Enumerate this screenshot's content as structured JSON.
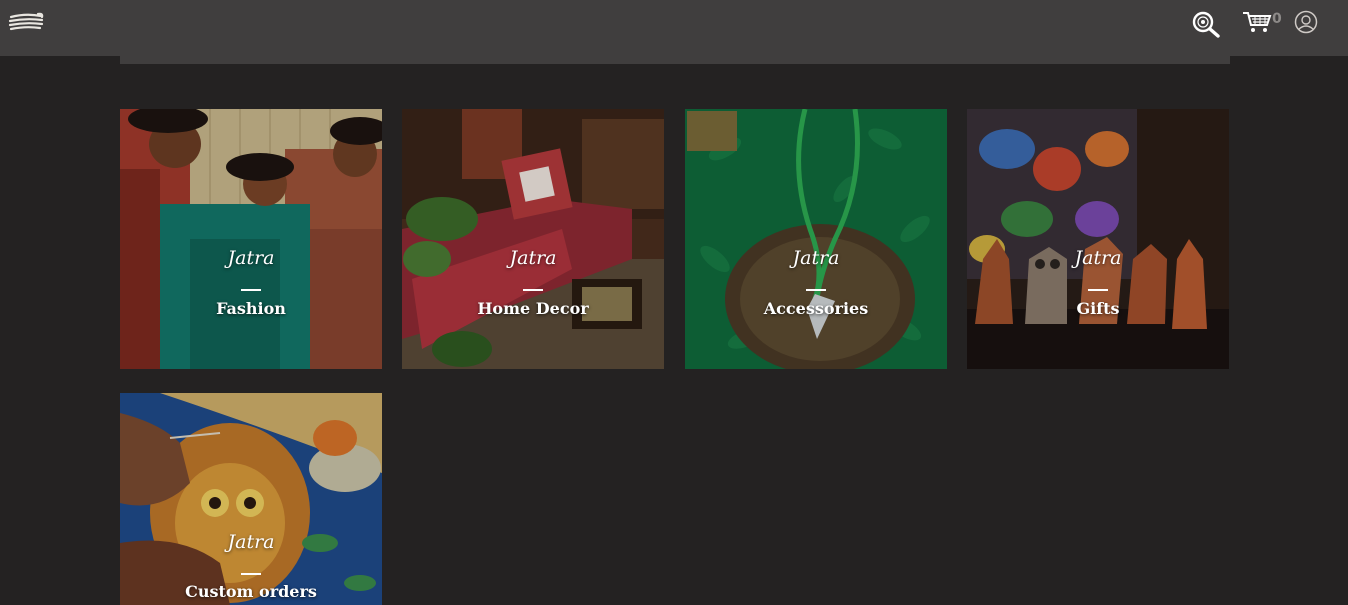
{
  "header": {
    "menu_icon": "rope-coil-menu-icon",
    "search_icon": "magnifier-search-icon",
    "cart_icon": "shopping-cart-icon",
    "cart_count": "0",
    "account_icon": "user-avatar-icon"
  },
  "categories": [
    {
      "brand": "Jatra",
      "label": "Fashion"
    },
    {
      "brand": "Jatra",
      "label": "Home Decor"
    },
    {
      "brand": "Jatra",
      "label": "Accessories"
    },
    {
      "brand": "Jatra",
      "label": "Gifts"
    },
    {
      "brand": "Jatra",
      "label": "Custom orders"
    }
  ],
  "colors": {
    "page_background": "#242222",
    "header_background": "#403e3e",
    "text": "#ffffff"
  }
}
